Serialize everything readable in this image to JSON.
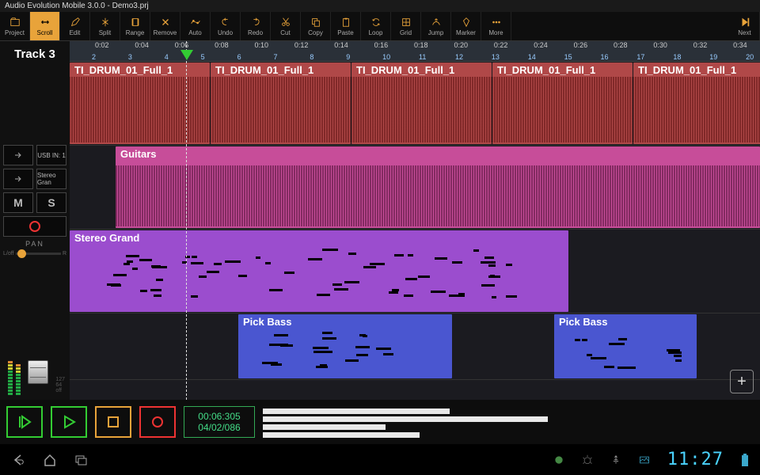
{
  "title": "Audio Evolution Mobile 3.0.0 - Demo3.prj",
  "toolbar": [
    {
      "id": "project",
      "label": "Project"
    },
    {
      "id": "scroll",
      "label": "Scroll",
      "active": true
    },
    {
      "id": "edit",
      "label": "Edit"
    },
    {
      "id": "split",
      "label": "Split"
    },
    {
      "id": "range",
      "label": "Range"
    },
    {
      "id": "remove",
      "label": "Remove"
    },
    {
      "id": "auto",
      "label": "Auto"
    },
    {
      "id": "undo",
      "label": "Undo"
    },
    {
      "id": "redo",
      "label": "Redo"
    },
    {
      "id": "cut",
      "label": "Cut"
    },
    {
      "id": "copy",
      "label": "Copy"
    },
    {
      "id": "paste",
      "label": "Paste"
    },
    {
      "id": "loop",
      "label": "Loop"
    },
    {
      "id": "grid",
      "label": "Grid"
    },
    {
      "id": "jump",
      "label": "Jump"
    },
    {
      "id": "marker",
      "label": "Marker"
    },
    {
      "id": "more",
      "label": "More"
    }
  ],
  "next_label": "Next",
  "side": {
    "track_name": "Track 3",
    "in_label": "USB IN: 1",
    "inst_label": "Stereo Gran",
    "mute": "M",
    "solo": "S",
    "pan": "PAN",
    "pan_l": "L/off",
    "pan_r": "R",
    "ticks": [
      "127",
      "64",
      "off"
    ]
  },
  "ruler_time": [
    "0:02",
    "0:04",
    "0:06",
    "0:08",
    "0:10",
    "0:12",
    "0:14",
    "0:16",
    "0:18",
    "0:20",
    "0:22",
    "0:24",
    "0:26",
    "0:28",
    "0:30",
    "0:32",
    "0:34"
  ],
  "ruler_beat": [
    "2",
    "3",
    "4",
    "5",
    "6",
    "7",
    "8",
    "9",
    "10",
    "11",
    "12",
    "13",
    "14",
    "15",
    "16",
    "17",
    "18",
    "19",
    "20"
  ],
  "clips": {
    "drum_name": "TI_DRUM_01_Full_1",
    "guitars": "Guitars",
    "grand": "Stereo Grand",
    "bass": "Pick Bass"
  },
  "transport": {
    "time": "00:06:305",
    "pos": "04/02/086"
  },
  "clock": "11:27"
}
